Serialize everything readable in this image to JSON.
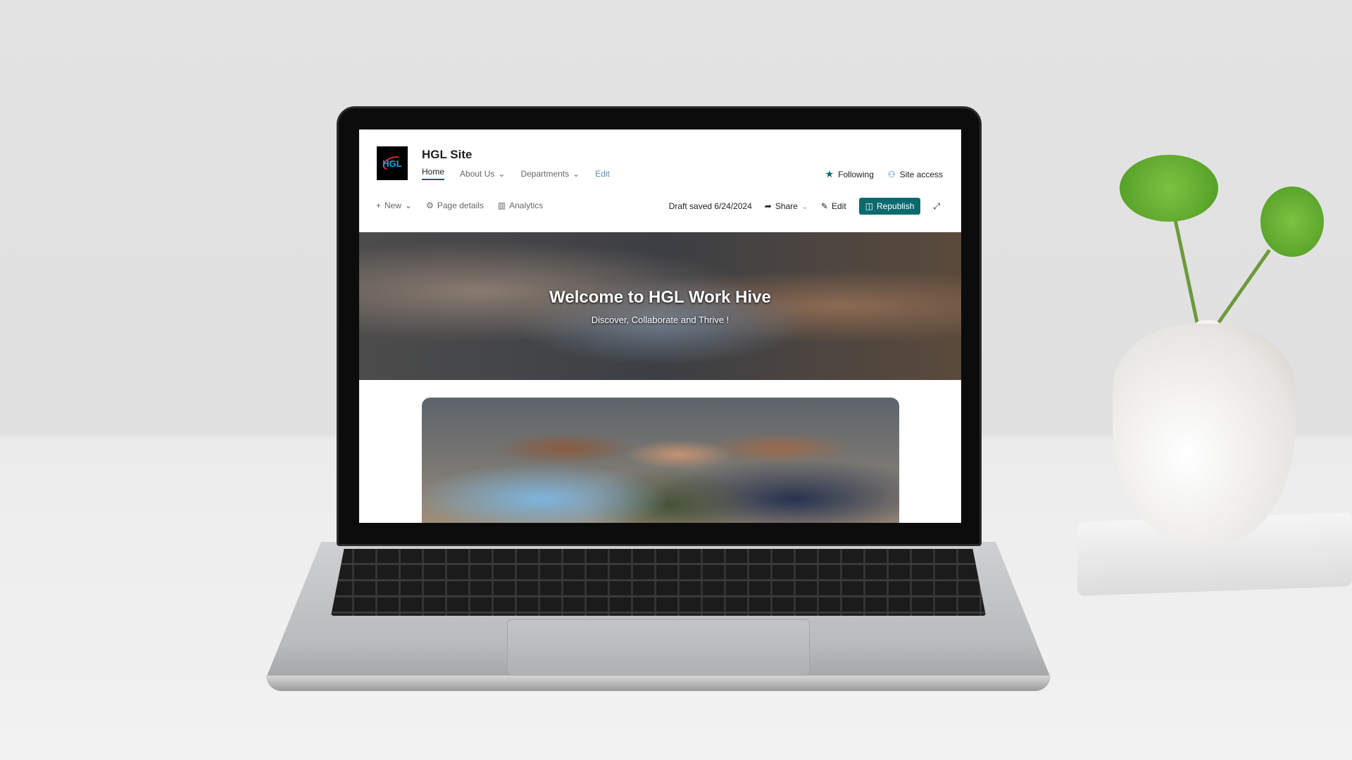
{
  "site": {
    "title": "HGL Site",
    "logo_text": "HGL"
  },
  "nav": {
    "items": [
      {
        "label": "Home",
        "active": true
      },
      {
        "label": "About Us"
      },
      {
        "label": "Departments"
      }
    ],
    "edit": "Edit"
  },
  "header_actions": {
    "following": "Following",
    "site_access": "Site access"
  },
  "toolbar": {
    "new": "New",
    "page_details": "Page details",
    "analytics": "Analytics",
    "draft_status": "Draft saved 6/24/2024",
    "share": "Share",
    "edit": "Edit",
    "republish": "Republish"
  },
  "hero": {
    "title": "Welcome to HGL Work Hive",
    "subtitle": "Discover, Collaborate and Thrive !"
  },
  "colors": {
    "accent": "#0a6b6e",
    "link": "#5b8bb5"
  }
}
